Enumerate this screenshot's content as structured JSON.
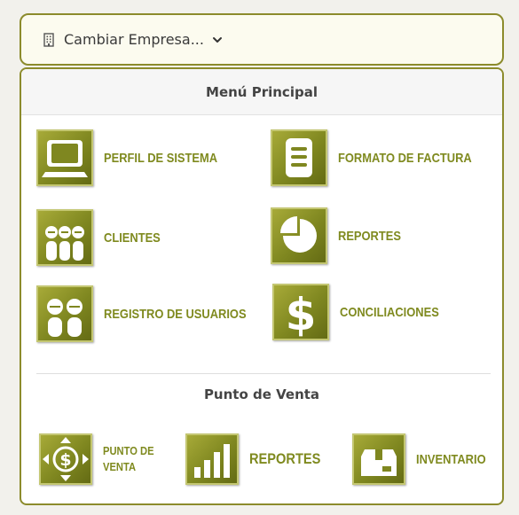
{
  "company_switcher": {
    "label": "Cambiar Empresa...",
    "icon": "building-icon",
    "dropdown_icon": "chevron-down-icon"
  },
  "main_menu": {
    "title": "Menú Principal",
    "items": [
      {
        "label": "PERFIL DE SISTEMA",
        "icon": "computer-icon"
      },
      {
        "label": "FORMATO DE FACTURA",
        "icon": "document-icon"
      },
      {
        "label": "CLIENTES",
        "icon": "clients-icon"
      },
      {
        "label": "REPORTES",
        "icon": "pie-chart-icon"
      },
      {
        "label": "REGISTRO DE USUARIOS",
        "icon": "users-icon"
      },
      {
        "label": "CONCILIACIONES",
        "icon": "dollar-icon"
      }
    ]
  },
  "pos_menu": {
    "title": "Punto de Venta",
    "items": [
      {
        "label": "PUNTO DE VENTA",
        "icon": "dollar-arrows-icon"
      },
      {
        "label": "REPORTES",
        "icon": "bar-chart-icon"
      },
      {
        "label": "INVENTARIO",
        "icon": "box-icon"
      }
    ]
  },
  "colors": {
    "accent": "#8c8b2c",
    "label": "#7f8a1f",
    "tile": "#7f8720"
  }
}
